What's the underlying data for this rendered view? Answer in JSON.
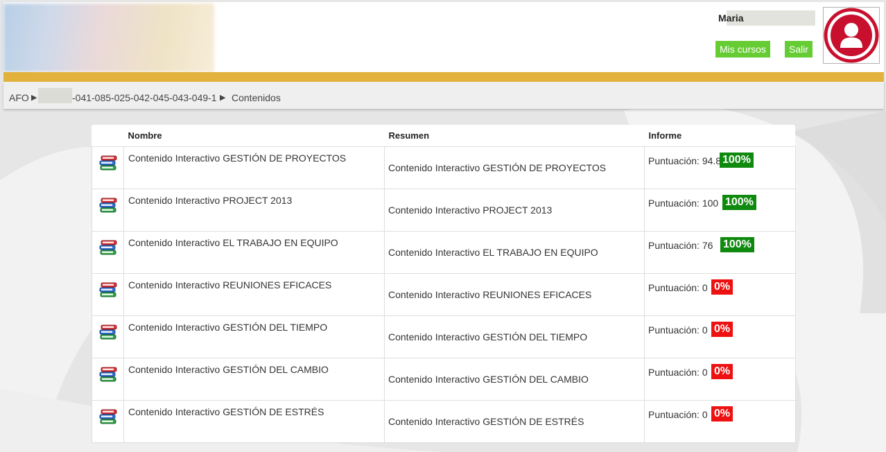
{
  "header": {
    "user_name": "Maria",
    "buttons": {
      "my_courses": "Mis cursos",
      "logout": "Salir"
    }
  },
  "breadcrumb": {
    "root": "AFO",
    "separator": "▶",
    "course_code": "-041-085-025-042-045-043-049-1",
    "current": "Contenidos"
  },
  "table": {
    "columns": {
      "name": "Nombre",
      "summary": "Resumen",
      "report": "Informe"
    },
    "rows": [
      {
        "name": "Contenido Interactivo GESTIÓN DE PROYECTOS",
        "summary": "Contenido Interactivo GESTIÓN DE PROYECTOS",
        "score": "Puntuación: 94.8",
        "progress": "100%",
        "status": "ok"
      },
      {
        "name": "Contenido Interactivo PROJECT 2013",
        "summary": "Contenido Interactivo PROJECT 2013",
        "score": "Puntuación: 100",
        "progress": "100%",
        "status": "ok"
      },
      {
        "name": "Contenido Interactivo EL TRABAJO EN EQUIPO",
        "summary": "Contenido Interactivo EL TRABAJO EN EQUIPO",
        "score": "Puntuación: 76",
        "progress": "100%",
        "status": "ok"
      },
      {
        "name": "Contenido Interactivo REUNIONES EFICACES",
        "summary": "Contenido Interactivo REUNIONES EFICACES",
        "score": "Puntuación: 0",
        "progress": "0%",
        "status": "ko"
      },
      {
        "name": "Contenido Interactivo GESTIÓN DEL TIEMPO",
        "summary": "Contenido Interactivo GESTIÓN DEL TIEMPO",
        "score": "Puntuación: 0",
        "progress": "0%",
        "status": "ko"
      },
      {
        "name": "Contenido Interactivo GESTIÓN DEL CAMBIO",
        "summary": "Contenido Interactivo GESTIÓN DEL CAMBIO",
        "score": "Puntuación: 0",
        "progress": "0%",
        "status": "ko"
      },
      {
        "name": "Contenido Interactivo GESTIÓN DE ESTRÉS",
        "summary": "Contenido Interactivo GESTIÓN DE ESTRÉS",
        "score": "Puntuación: 0",
        "progress": "0%",
        "status": "ko"
      }
    ]
  },
  "icons": {
    "row_icon": "books-icon",
    "avatar": "user-avatar-icon"
  },
  "colors": {
    "accent_bar": "#e3b23c",
    "button_green": "#66cc33",
    "badge_ok": "#0f8a0f",
    "badge_ko": "#ee1111",
    "avatar_red": "#c8102e"
  }
}
